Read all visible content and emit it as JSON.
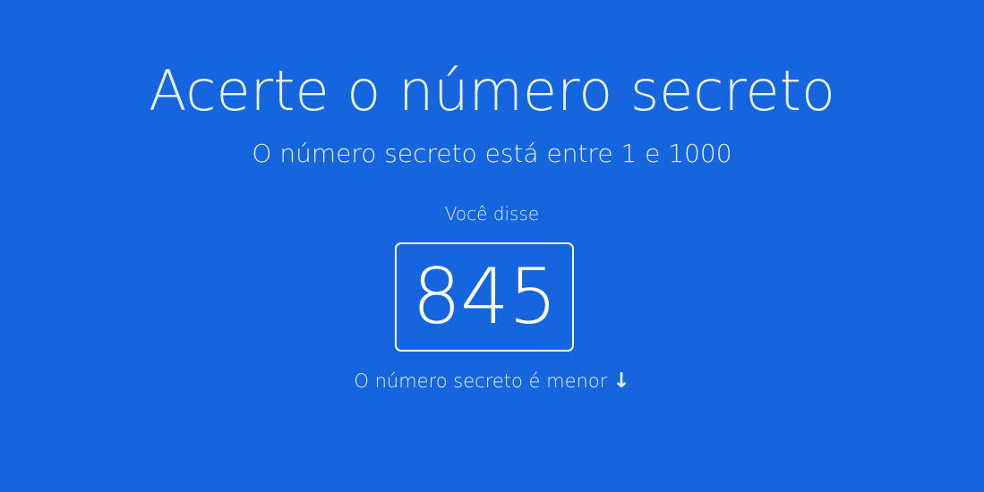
{
  "page": {
    "title": "Acerte o número secreto",
    "subtitle": "O número secreto está entre 1 e 1000",
    "you_said_label": "Você disse",
    "guess": "845",
    "hint_text": "O número secreto é menor",
    "hint_icon": "arrow-down-icon",
    "colors": {
      "background": "#1565df",
      "text": "#e9f2ff",
      "border": "#ffffff"
    }
  }
}
